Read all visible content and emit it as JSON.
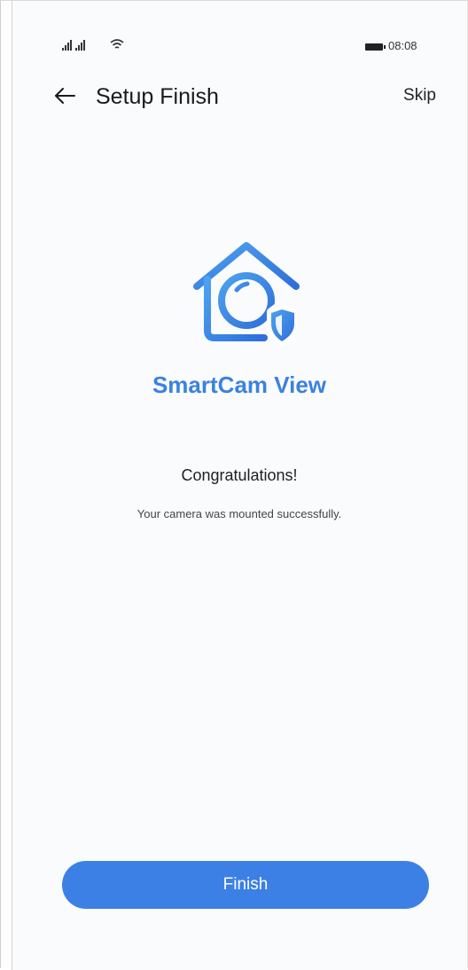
{
  "status_bar": {
    "time": "08:08",
    "icons": [
      "signal-icon",
      "signal-icon",
      "wifi-icon",
      "battery-icon"
    ]
  },
  "header": {
    "back_icon": "arrow-left-icon",
    "title": "Setup Finish",
    "skip_label": "Skip"
  },
  "logo": {
    "icon": "home-camera-shield-icon",
    "app_name": "SmartCam View",
    "accent_color": "#3a82df"
  },
  "message": {
    "headline": "Congratulations!",
    "detail": "Your camera was mounted successfully."
  },
  "footer": {
    "finish_label": "Finish",
    "button_color": "#3c80e6"
  }
}
